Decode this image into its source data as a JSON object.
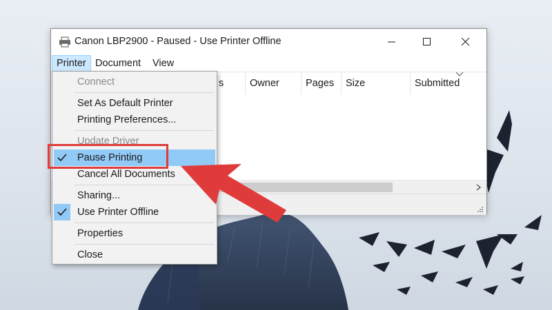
{
  "window": {
    "title": "Canon LBP2900 - Paused  -  Use Printer Offline",
    "app_icon": "printer-icon"
  },
  "menubar": {
    "items": [
      {
        "label": "Printer"
      },
      {
        "label": "Document"
      },
      {
        "label": "View"
      }
    ]
  },
  "list": {
    "columns": [
      {
        "label": "s"
      },
      {
        "label": "Owner"
      },
      {
        "label": "Pages"
      },
      {
        "label": "Size"
      },
      {
        "label": "Submitted"
      }
    ]
  },
  "dropdown": {
    "items": [
      {
        "label": "Connect",
        "enabled": false,
        "checked": false
      },
      {
        "label": "Set As Default Printer",
        "enabled": true,
        "checked": false
      },
      {
        "label": "Printing Preferences...",
        "enabled": true,
        "checked": false
      },
      {
        "label": "Update Driver",
        "enabled": false,
        "checked": false
      },
      {
        "label": "Pause Printing",
        "enabled": true,
        "checked": true,
        "highlighted": true
      },
      {
        "label": "Cancel All Documents",
        "enabled": true,
        "checked": false
      },
      {
        "label": "Sharing...",
        "enabled": true,
        "checked": false
      },
      {
        "label": "Use Printer Offline",
        "enabled": true,
        "checked": true
      },
      {
        "label": "Properties",
        "enabled": true,
        "checked": false
      },
      {
        "label": "Close",
        "enabled": true,
        "checked": false
      }
    ]
  },
  "colors": {
    "highlight": "#91c9f7",
    "annotation": "#e03b3b",
    "menu_selected": "#cce8ff"
  }
}
